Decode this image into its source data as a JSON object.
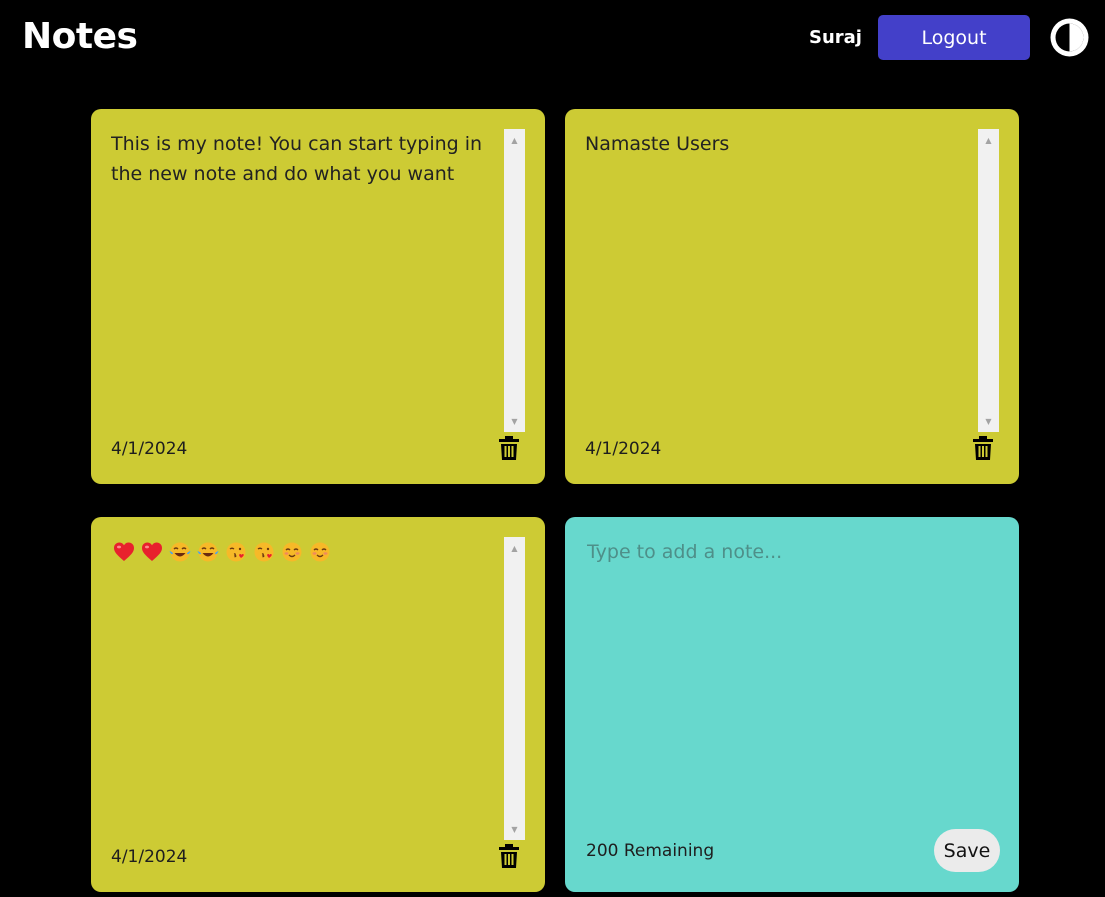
{
  "header": {
    "title": "Notes",
    "username": "Suraj",
    "logout_label": "Logout",
    "theme_toggle_icon": "contrast-icon"
  },
  "notes": [
    {
      "text": "This is my note! You can start typing in the new note and do what you want",
      "date": "4/1/2024",
      "color": "#cdcb34"
    },
    {
      "text": "Namaste Users",
      "date": "4/1/2024",
      "color": "#cdcb34"
    },
    {
      "emojis": [
        "red-heart",
        "red-heart",
        "tears-of-joy",
        "tears-of-joy",
        "face-blowing-kiss",
        "face-blowing-kiss",
        "smiling-face-with-hearts",
        "smiling-face-with-hearts"
      ],
      "date": "4/1/2024",
      "color": "#cdcb34"
    }
  ],
  "new_note": {
    "placeholder": "Type to add a note...",
    "remaining": "200 Remaining",
    "save_label": "Save",
    "color": "#67d8cd"
  },
  "colors": {
    "background": "#000000",
    "accent": "#4340c9",
    "note_yellow": "#cdcb34",
    "note_teal": "#67d8cd"
  }
}
